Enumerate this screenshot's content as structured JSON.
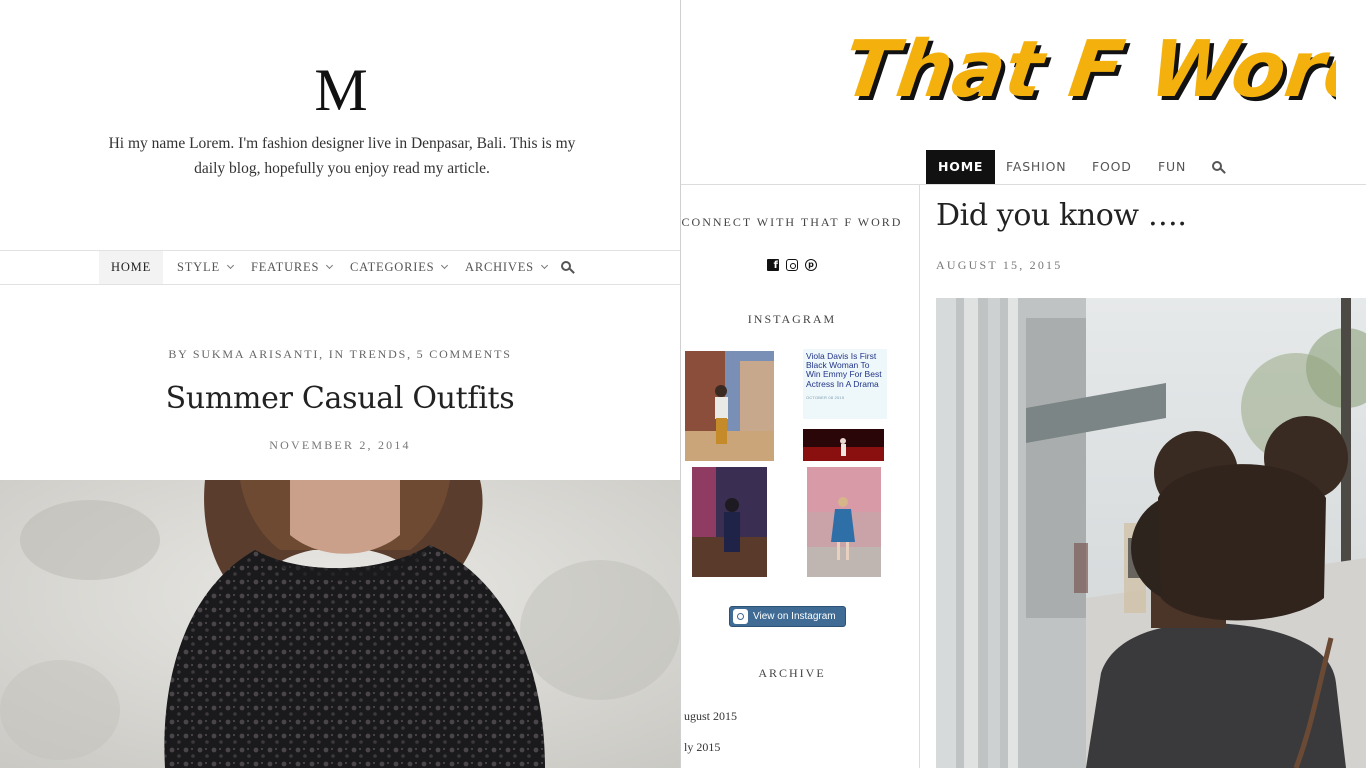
{
  "left_blog": {
    "logo": "M",
    "intro": "Hi my name Lorem. I'm fashion designer live in Denpasar, Bali. This is my daily blog, hopefully you enjoy read my article.",
    "nav": {
      "home": "HOME",
      "style": "STYLE",
      "features": "FEATURES",
      "categories": "CATEGORIES",
      "archives": "ARCHIVES"
    },
    "post": {
      "byline": "BY SUKMA ARISANTI, IN TRENDS, 5 COMMENTS",
      "title": "Summer Casual Outfits",
      "date": "NOVEMBER 2, 2014"
    }
  },
  "right_blog": {
    "brand": "That F Word",
    "nav": {
      "home": "HOME",
      "fashion": "FASHION",
      "food": "FOOD",
      "fun": "FUN"
    },
    "sidebar": {
      "connect_title": "CONNECT WITH THAT F WORD",
      "instagram_title": "INSTAGRAM",
      "news_headline": "Viola Davis Is First Black Woman To Win Emmy For Best Actress In A Drama",
      "news_meta": "OCTOBER 08 2015",
      "view_on_instagram": "View on Instagram",
      "archive_title": "ARCHIVE",
      "archive_items": [
        "ugust 2015",
        "ly 2015"
      ]
    },
    "post": {
      "title": "Did you know ….",
      "date": "AUGUST 15, 2015"
    }
  },
  "colors": {
    "brand_yellow": "#F4B10E",
    "active_nav_dark": "#111111",
    "instagram_button": "#3F6B94",
    "news_link": "#22358A"
  }
}
